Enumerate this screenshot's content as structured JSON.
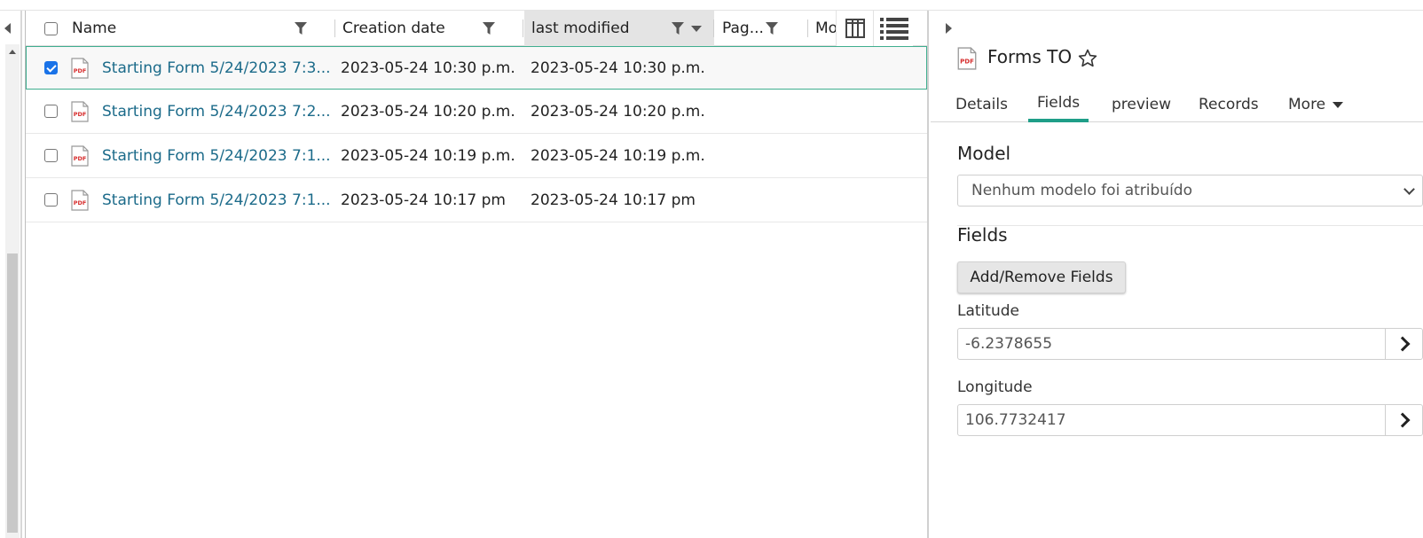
{
  "grid": {
    "columns": [
      "Name",
      "Creation date",
      "last modified",
      "Pag...",
      "Mo"
    ],
    "rows": [
      {
        "name": "Starting Form 5/24/2023 7:3...",
        "created": "2023-05-24 10:30 p.m.",
        "modified": "2023-05-24 10:30 p.m.",
        "checked": true,
        "icon": "pdf-icon"
      },
      {
        "name": "Starting Form 5/24/2023 7:2...",
        "created": "2023-05-24 10:20 p.m.",
        "modified": "2023-05-24 10:20 p.m.",
        "checked": false,
        "icon": "pdf-icon"
      },
      {
        "name": "Starting Form 5/24/2023 7:1...",
        "created": "2023-05-24 10:19 p.m.",
        "modified": "2023-05-24 10:19 p.m.",
        "checked": false,
        "icon": "pdf-icon"
      },
      {
        "name": "Starting Form 5/24/2023 7:1...",
        "created": "2023-05-24 10:17 pm",
        "modified": "2023-05-24 10:17 pm",
        "checked": false,
        "icon": "pdf-icon"
      }
    ]
  },
  "panel": {
    "title": "Forms TO",
    "tabs": [
      "Details",
      "Fields",
      "preview",
      "Records",
      "More"
    ],
    "model_label": "Model",
    "model_value": "Nenhum modelo foi atribuído",
    "fields_label": "Fields",
    "add_remove_label": "Add/Remove Fields",
    "latitude_label": "Latitude",
    "latitude_value": "-6.2378655",
    "longitude_label": "Longitude",
    "longitude_value": "106.7732417"
  },
  "colors": {
    "link": "#1c6b8a",
    "active_tab": "#1f9e88",
    "selected_border": "#3fae8f",
    "pdf_red": "#d62d2d"
  }
}
